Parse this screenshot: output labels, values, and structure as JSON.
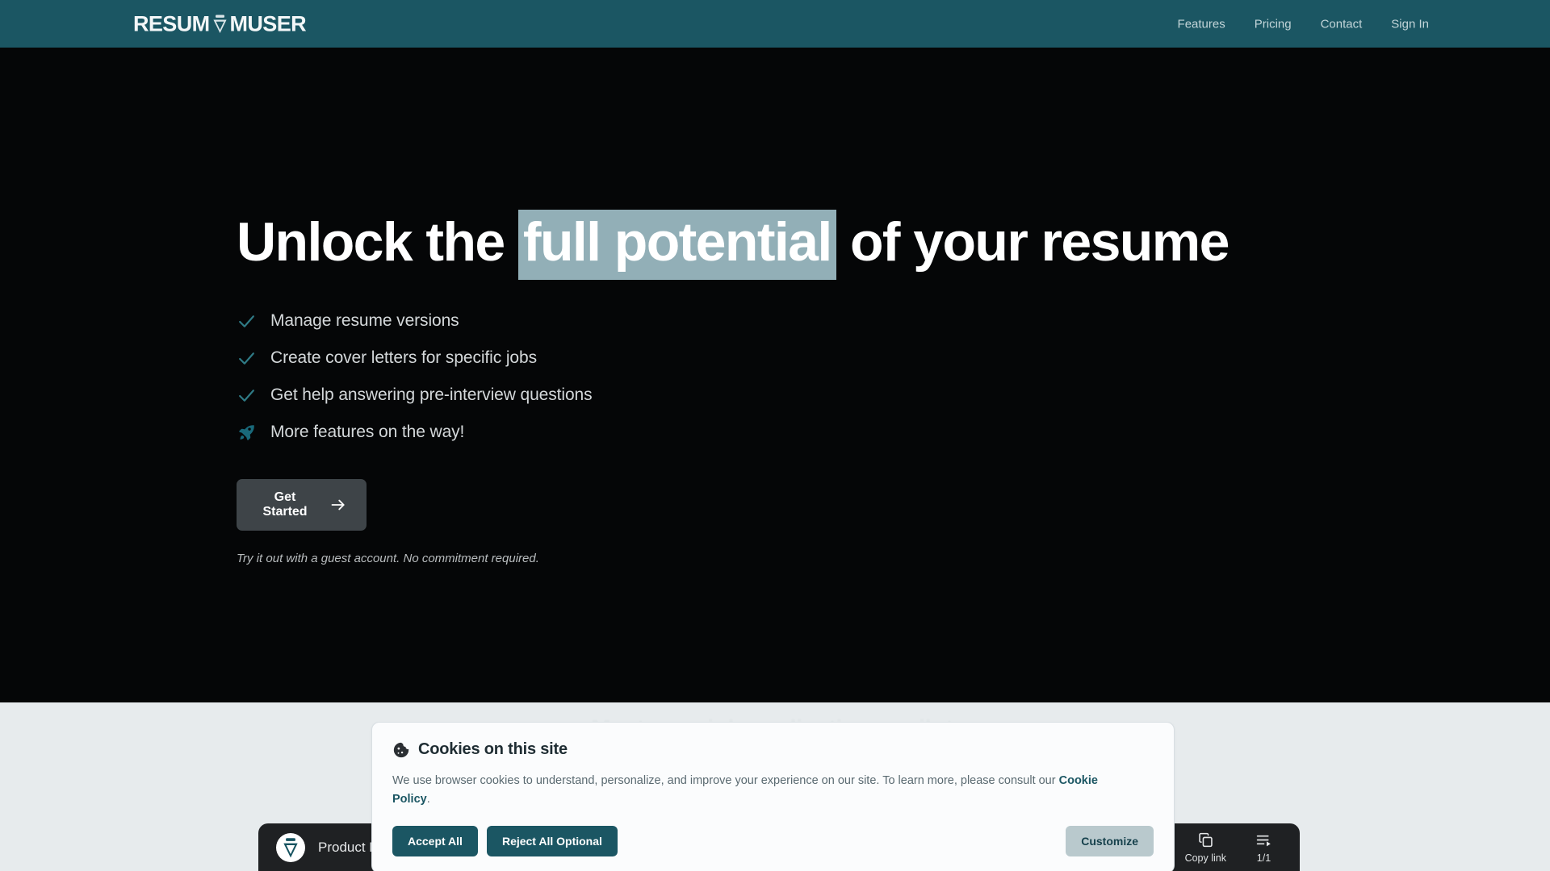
{
  "header": {
    "logo_prefix": "RESUM",
    "logo_suffix": "MUSER",
    "logo_icon": "resume-badge-icon",
    "nav": [
      {
        "label": "Features"
      },
      {
        "label": "Pricing"
      },
      {
        "label": "Contact"
      },
      {
        "label": "Sign In"
      }
    ]
  },
  "hero": {
    "headline_before": "Unlock the ",
    "headline_highlight": "full potential",
    "headline_after": " of your resume",
    "features": [
      {
        "icon": "check-icon",
        "label": "Manage resume versions"
      },
      {
        "icon": "check-icon",
        "label": "Create cover letters for specific jobs"
      },
      {
        "icon": "check-icon",
        "label": "Get help answering pre-interview questions"
      },
      {
        "icon": "rocket-icon",
        "label": "More features on the way!"
      }
    ],
    "cta_label": "Get Started",
    "cta_icon": "arrow-right-icon",
    "cta_note": "Try it out with a guest account. No commitment required."
  },
  "lower": {
    "tagline": "Meet your job application copilot."
  },
  "video_bar": {
    "avatar_icon": "resume-badge-avatar-icon",
    "title": "Product Demo | How to Prepare a Job Application | ResumeMuser",
    "controls": [
      {
        "icon": "copy-link-icon",
        "label": "Copy link"
      },
      {
        "icon": "playlist-icon",
        "label": "1/1"
      }
    ]
  },
  "cookie_banner": {
    "icon": "cookie-icon",
    "title": "Cookies on this site",
    "body_before": "We use browser cookies to understand, personalize, and improve your experience on our site. To learn more, please consult our ",
    "body_link": "Cookie Policy",
    "body_after": ".",
    "accept_label": "Accept All",
    "reject_label": "Reject All Optional",
    "customize_label": "Customize"
  },
  "colors": {
    "brand_teal": "#1b5663",
    "highlight": "#92afb7",
    "hero_bg": "#050607",
    "lower_bg": "#e7ebed",
    "cta_bg": "#3e4448",
    "accent_check": "#2f7a85"
  }
}
